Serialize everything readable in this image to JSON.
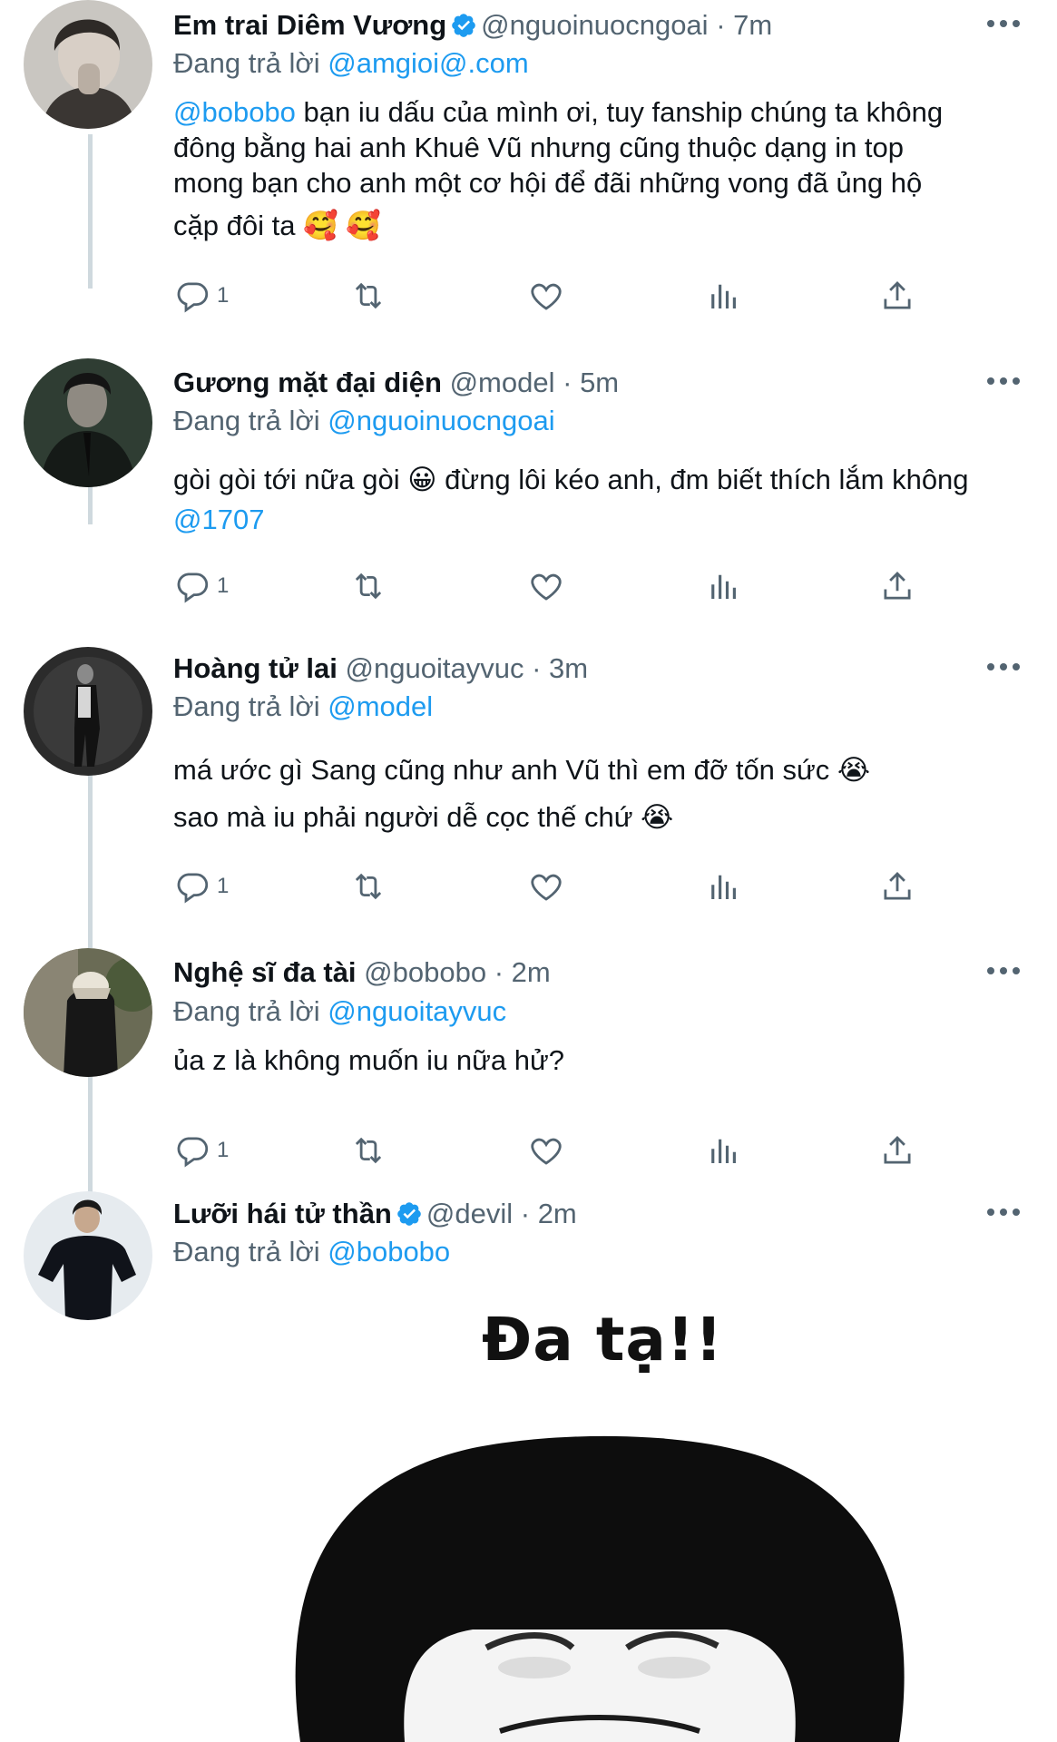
{
  "tweets": [
    {
      "name": "Em trai Diêm Vương",
      "handle": "@nguoinuocngoai",
      "time": "7m",
      "verified": true,
      "replying_label": "Đang trả lời",
      "replying_to": "@amgioi@.com",
      "body_mention": "@bobobo",
      "body_lines": [
        " bạn iu dấu của mình ơi, tuy fanship chúng ta không",
        "đông bằng hai anh Khuê Vũ nhưng cũng thuộc dạng in top",
        "mong bạn cho anh một cơ hội để đãi những vong đã ủng hộ",
        "cặp đôi ta 🥰 🥰"
      ],
      "reply_count": "1"
    },
    {
      "name": "Gương mặt đại diện",
      "handle": "@model",
      "time": "5m",
      "verified": false,
      "replying_label": "Đang trả lời",
      "replying_to": "@nguoinuocngoai",
      "body_lines": [
        "gòi gòi tới nữa gòi 😀 đừng lôi kéo anh, đm biết thích lắm không"
      ],
      "body_mention_end": "@1707",
      "reply_count": "1"
    },
    {
      "name": "Hoàng tử lai",
      "handle": "@nguoitayvuc",
      "time": "3m",
      "verified": false,
      "replying_label": "Đang trả lời",
      "replying_to": "@model",
      "body_lines": [
        "má ước gì Sang cũng như anh Vũ thì em đỡ tốn sức 😭",
        "sao mà iu phải người dễ cọc thế chứ 😭"
      ],
      "reply_count": "1"
    },
    {
      "name": "Nghệ sĩ đa tài",
      "handle": "@bobobo",
      "time": "2m",
      "verified": false,
      "replying_label": "Đang trả lời",
      "replying_to": "@nguoitayvuc",
      "body_lines": [
        "ủa z là không muốn iu nữa hử?"
      ],
      "reply_count": "1"
    },
    {
      "name": "Lưỡi hái tử thần",
      "handle": "@devil",
      "time": "2m",
      "verified": true,
      "replying_label": "Đang trả lời",
      "replying_to": "@bobobo",
      "image_text": "Đa tạ!!"
    }
  ],
  "separator": "·",
  "icons": {
    "reply": "reply-icon",
    "retweet": "retweet-icon",
    "like": "heart-icon",
    "views": "bar-chart-icon",
    "share": "share-icon",
    "more": "more-dots-icon",
    "verified": "verified-badge-icon"
  },
  "colors": {
    "link": "#1d9bf0",
    "secondary_text": "#536471",
    "thread_line": "#cfd9de"
  }
}
